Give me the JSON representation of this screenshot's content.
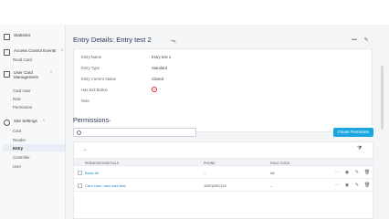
{
  "sidebar": {
    "groups": [
      {
        "label": "Statistics",
        "icon": "chart-icon"
      },
      {
        "label": "Access Control Events",
        "icon": "calendar-icon",
        "subitems": [
          "Read Card"
        ]
      },
      {
        "label": "User Card Management",
        "icon": "card-icon",
        "subitems": [
          "Card User",
          "Role",
          "Permission"
        ]
      },
      {
        "label": "Site Settings",
        "icon": "gear-icon",
        "subitems": [
          "Card",
          "Reader",
          "Entry",
          "Controller",
          "User"
        ]
      }
    ],
    "active": "Entry"
  },
  "header": {
    "title": "Entry Details: Entry test 2"
  },
  "details": {
    "rows": [
      {
        "label": "Entry Name",
        "value": "Entry test 2"
      },
      {
        "label": "Entry Type",
        "value": "Standard"
      },
      {
        "label": "Entry Current Status",
        "value": "Closed"
      },
      {
        "label": "Has Exit Button",
        "value": ""
      },
      {
        "label": "Note",
        "value": ""
      }
    ]
  },
  "permissions": {
    "title": "Permissions",
    "search_placeholder": "Search",
    "create_label": "Create Permission",
    "columns": [
      "Permissiondetails",
      "Phone",
      "Role code"
    ],
    "rows": [
      {
        "details": "Basic All",
        "phone": "--",
        "role": "All"
      },
      {
        "details": "Card User, user card test",
        "phone": "1987(0821)15",
        "role": "--"
      }
    ]
  },
  "colors": {
    "accent": "#1ba6e0",
    "link": "#1a86c7",
    "danger": "#dd3333"
  }
}
